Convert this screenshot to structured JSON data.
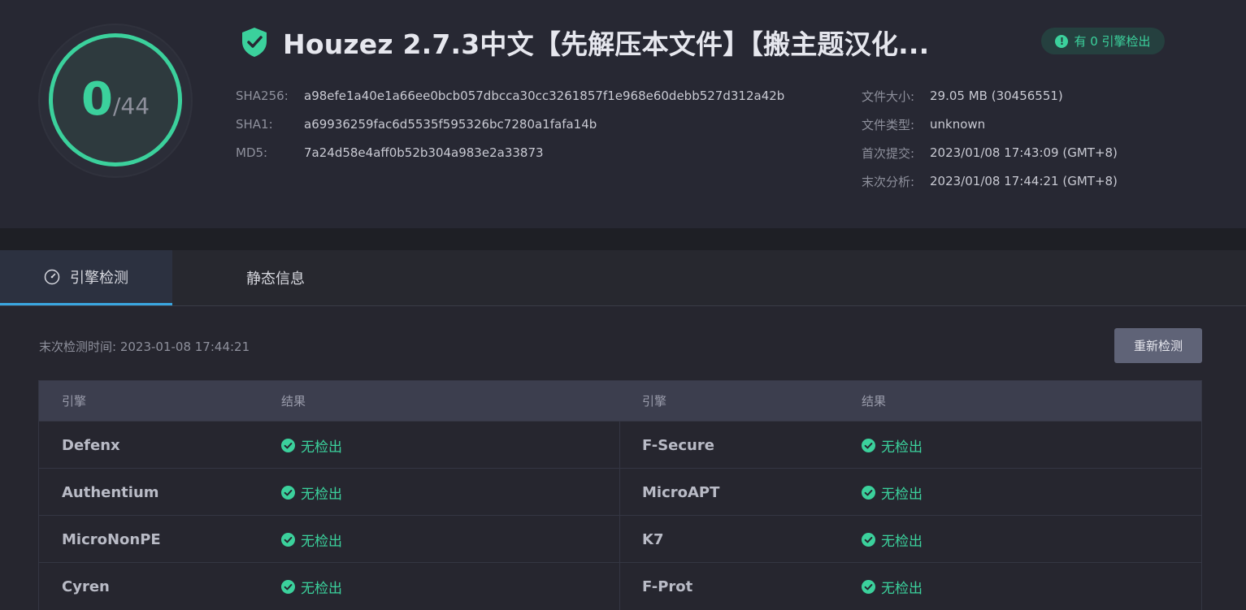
{
  "score": {
    "detected": "0",
    "total": "/44"
  },
  "file": {
    "title": "Houzez 2.7.3中文【先解压本文件】【搬主题汉化...",
    "badge_text": "有 0 引擎检出",
    "hashes": [
      {
        "label": "SHA256:",
        "value": "a98efe1a40e1a66ee0bcb057dbcca30cc3261857f1e968e60debb527d312a42b"
      },
      {
        "label": "SHA1:",
        "value": "a69936259fac6d5535f595326bc7280a1fafa14b"
      },
      {
        "label": "MD5:",
        "value": "7a24d58e4aff0b52b304a983e2a33873"
      }
    ],
    "meta": [
      {
        "label": "文件大小:",
        "value": "29.05 MB (30456551)"
      },
      {
        "label": "文件类型:",
        "value": "unknown"
      },
      {
        "label": "首次提交:",
        "value": "2023/01/08 17:43:09 (GMT+8)"
      },
      {
        "label": "末次分析:",
        "value": "2023/01/08 17:44:21 (GMT+8)"
      }
    ]
  },
  "tabs": [
    {
      "label": "引擎检测",
      "icon": "gauge-icon",
      "active": true
    },
    {
      "label": "静态信息",
      "active": false
    }
  ],
  "scan": {
    "last_time": "末次检测时间: 2023-01-08 17:44:21",
    "recheck_label": "重新检测"
  },
  "table": {
    "headers": [
      "引擎",
      "结果",
      "引擎",
      "结果"
    ],
    "rows": [
      {
        "left_engine": "Defenx",
        "left_result": "无检出",
        "right_engine": "F-Secure",
        "right_result": "无检出"
      },
      {
        "left_engine": "Authentium",
        "left_result": "无检出",
        "right_engine": "MicroAPT",
        "right_result": "无检出"
      },
      {
        "left_engine": "MicroNonPE",
        "left_result": "无检出",
        "right_engine": "K7",
        "right_result": "无检出"
      },
      {
        "left_engine": "Cyren",
        "left_result": "无检出",
        "right_engine": "F-Prot",
        "right_result": "无检出"
      }
    ]
  },
  "colors": {
    "accent": "#3bd19c",
    "tab_underline": "#3aa6e0",
    "background": "#26262f"
  }
}
